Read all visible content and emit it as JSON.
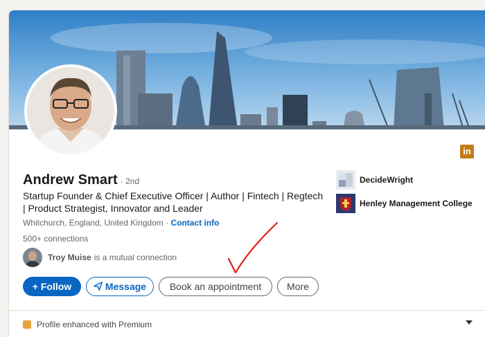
{
  "profile": {
    "name": "Andrew Smart",
    "degree": "· 2nd",
    "headline": "Startup Founder & Chief Executive Officer | Author | Fintech | Regtech | Product Strategist, Innovator and Leader",
    "location": "Whitchurch, England, United Kingdom ·",
    "contact_info": "Contact info",
    "connections": "500+ connections"
  },
  "mutual": {
    "name": "Troy Muise",
    "suffix": "is a mutual connection"
  },
  "buttons": {
    "follow": "+ Follow",
    "message": "Message",
    "book": "Book an appointment",
    "more": "More"
  },
  "companies": [
    {
      "name": "DecideWright"
    },
    {
      "name": "Henley Management College"
    }
  ],
  "premium": {
    "label": "Profile enhanced with Premium"
  },
  "badge": {
    "label": "in"
  },
  "colors": {
    "accent": "#0a66c2",
    "premium": "#c37d16",
    "annotation": "#e0201a"
  },
  "icons": {
    "message": "send-icon",
    "premium": "premium-icon",
    "chevron": "chevron-down-icon"
  }
}
